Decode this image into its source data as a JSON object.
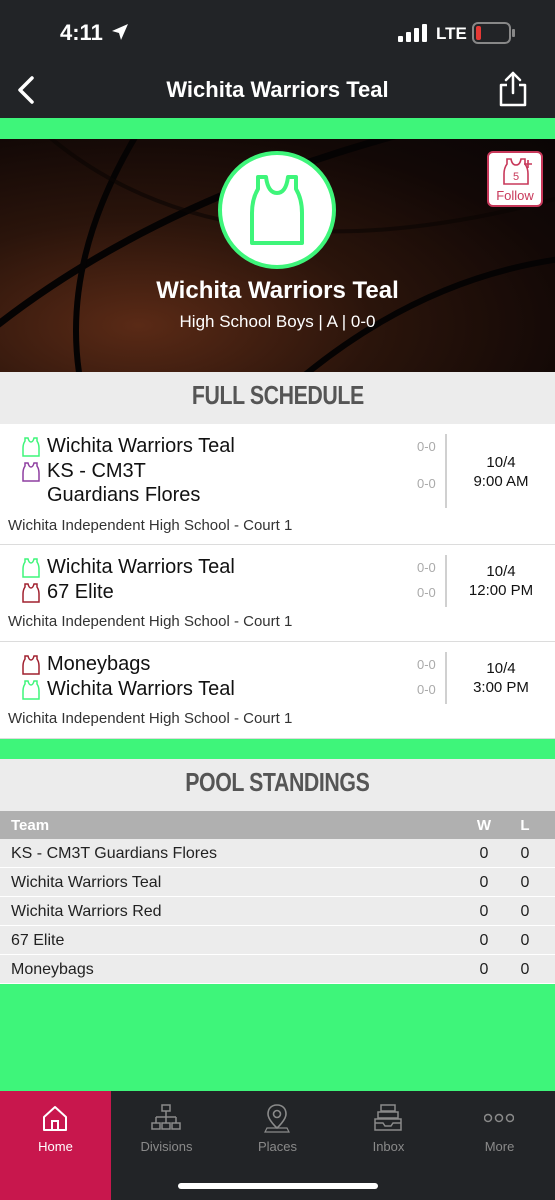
{
  "status_bar": {
    "time": "4:11",
    "network": "LTE",
    "battery_color": "#e53935"
  },
  "nav": {
    "title": "Wichita Warriors Teal"
  },
  "hero": {
    "team_name": "Wichita Warriors Teal",
    "subtitle": "High School Boys | A | 0-0",
    "follow_label": "Follow",
    "follow_count": "5"
  },
  "schedule": {
    "header": "FULL SCHEDULE",
    "games": [
      {
        "team1": "Wichita Warriors Teal",
        "team1_jersey": "#3ef57a",
        "team1_score": "0-0",
        "team2": "KS - CM3T",
        "team2_line2": "Guardians Flores",
        "team2_jersey": "#8e3fa0",
        "team2_score": "0-0",
        "date": "10/4",
        "time": "9:00 AM",
        "venue": "Wichita Independent High School - Court 1"
      },
      {
        "team1": "Wichita Warriors Teal",
        "team1_jersey": "#3ef57a",
        "team1_score": "0-0",
        "team2": "67 Elite",
        "team2_jersey": "#a0202f",
        "team2_score": "0-0",
        "date": "10/4",
        "time": "12:00 PM",
        "venue": "Wichita Independent High School - Court 1"
      },
      {
        "team1": "Moneybags",
        "team1_jersey": "#a0202f",
        "team1_score": "0-0",
        "team2": "Wichita Warriors Teal",
        "team2_jersey": "#3ef57a",
        "team2_score": "0-0",
        "date": "10/4",
        "time": "3:00 PM",
        "venue": "Wichita Independent High School - Court 1"
      }
    ]
  },
  "standings": {
    "header": "POOL STANDINGS",
    "columns": {
      "team": "Team",
      "w": "W",
      "l": "L"
    },
    "rows": [
      {
        "team": "KS - CM3T Guardians Flores",
        "w": "0",
        "l": "0"
      },
      {
        "team": "Wichita Warriors Teal",
        "w": "0",
        "l": "0"
      },
      {
        "team": "Wichita Warriors Red",
        "w": "0",
        "l": "0"
      },
      {
        "team": "67 Elite",
        "w": "0",
        "l": "0"
      },
      {
        "team": "Moneybags",
        "w": "0",
        "l": "0"
      }
    ]
  },
  "tabs": [
    {
      "label": "Home",
      "icon": "home-icon",
      "active": true
    },
    {
      "label": "Divisions",
      "icon": "hierarchy-icon",
      "active": false
    },
    {
      "label": "Places",
      "icon": "map-pin-icon",
      "active": false
    },
    {
      "label": "Inbox",
      "icon": "inbox-icon",
      "active": false
    },
    {
      "label": "More",
      "icon": "more-dots-icon",
      "active": false
    }
  ],
  "colors": {
    "accent_green": "#3ef57a",
    "active_tab": "#c8174d",
    "follow_red": "#c8385a",
    "dark_bar": "#222427"
  }
}
